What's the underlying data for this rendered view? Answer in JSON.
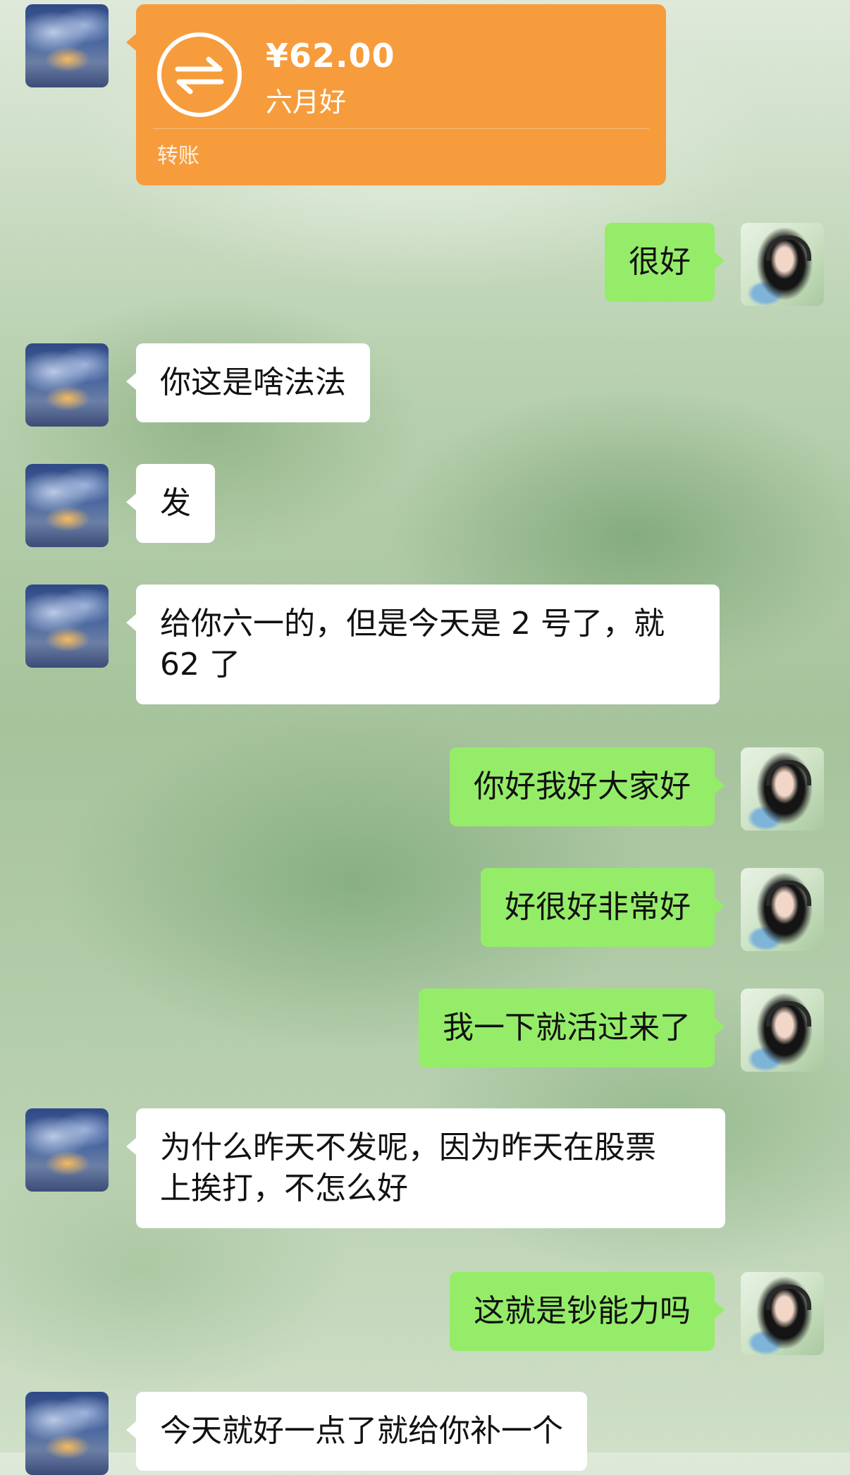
{
  "transfer": {
    "amount": "¥62.00",
    "note": "六月好",
    "label": "转账"
  },
  "messages": [
    {
      "side": "out",
      "text": "很好"
    },
    {
      "side": "in",
      "text": "你这是啥法法"
    },
    {
      "side": "in",
      "text": "发"
    },
    {
      "side": "in",
      "text": "给你六一的，但是今天是 2 号了，就\n62 了"
    },
    {
      "side": "out",
      "text": "你好我好大家好"
    },
    {
      "side": "out",
      "text": "好很好非常好"
    },
    {
      "side": "out",
      "text": "我一下就活过来了"
    },
    {
      "side": "in",
      "text": "为什么昨天不发呢，因为昨天在股票\n上挨打，不怎么好"
    },
    {
      "side": "out",
      "text": "这就是钞能力吗"
    },
    {
      "side": "in",
      "text": "今天就好一点了就给你补一个"
    }
  ],
  "colors": {
    "outgoing_bubble": "#95ec69",
    "incoming_bubble": "#ffffff",
    "transfer_card": "#f79c3c"
  },
  "icons": {
    "transfer": "transfer-arrows-icon"
  }
}
